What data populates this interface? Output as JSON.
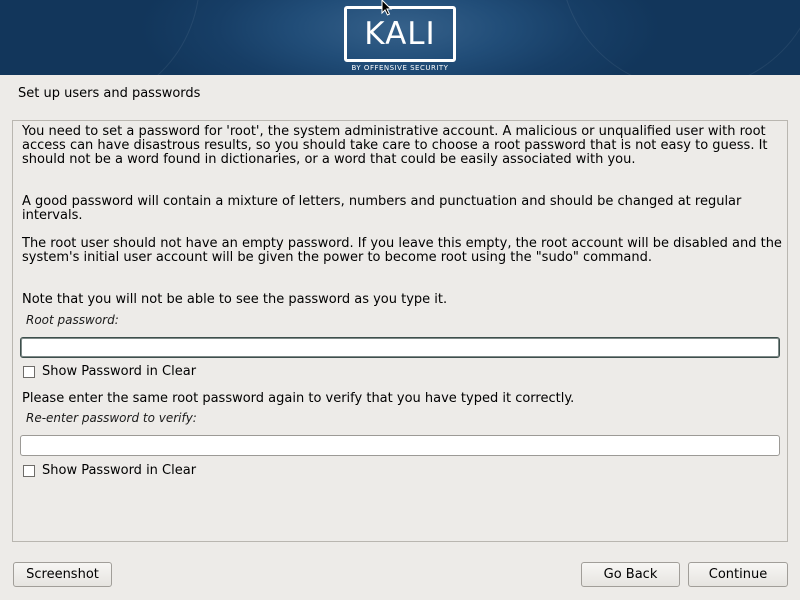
{
  "banner": {
    "logo_text": "KALI",
    "logo_subtitle": "BY OFFENSIVE SECURITY"
  },
  "page": {
    "title": "Set up users and passwords"
  },
  "content": {
    "para1": "You need to set a password for 'root', the system administrative account. A malicious or unqualified user with root access can have disastrous results, so you should take care to choose a root password that is not easy to guess. It should not be a word found in dictionaries, or a word that could be easily associated with you.",
    "para2": "A good password will contain a mixture of letters, numbers and punctuation and should be changed at regular intervals.",
    "para3": "The root user should not have an empty password. If you leave this empty, the root account will be disabled and the system's initial user account will be given the power to become root using the \"sudo\" command.",
    "para4": "Note that you will not be able to see the password as you type it.",
    "root_password_label": "Root password:",
    "root_password_value": "",
    "show_password_label_1": "Show Password in Clear",
    "show_password_checked_1": false,
    "verify_prompt": "Please enter the same root password again to verify that you have typed it correctly.",
    "verify_password_label": "Re-enter password to verify:",
    "verify_password_value": "",
    "show_password_label_2": "Show Password in Clear",
    "show_password_checked_2": false
  },
  "buttons": {
    "screenshot": "Screenshot",
    "go_back": "Go Back",
    "continue": "Continue"
  },
  "icons": {
    "cursor": "mouse-pointer-icon",
    "logo": "kali-logo-icon"
  },
  "colors": {
    "banner": "#173e66",
    "background": "#edebe8",
    "focus_border": "#3d4f4c"
  }
}
